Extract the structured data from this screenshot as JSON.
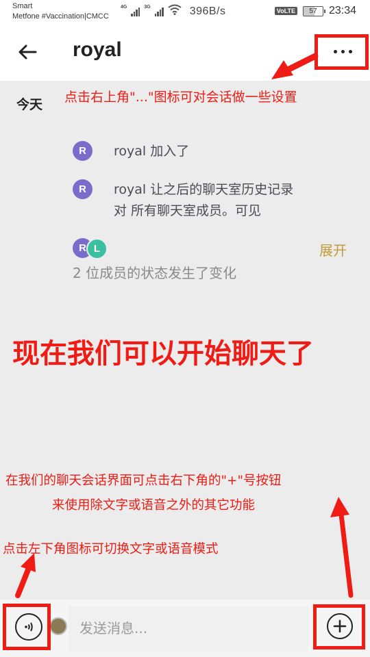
{
  "status_bar": {
    "carrier_line1": "Smart",
    "carrier_line2": "Metfone #Vaccination|CMCC",
    "net1": "4G",
    "net2": "3G",
    "net_rate": "396B/s",
    "volte": "VoLTE",
    "battery": "57",
    "battery_level": 0.57,
    "time": "23:34"
  },
  "header": {
    "title": "royal",
    "back_icon": "arrow-left-icon",
    "more_icon": "more-horizontal-icon"
  },
  "chat": {
    "day_label": "今天",
    "events": [
      {
        "avatar": "R",
        "text": "royal 加入了"
      },
      {
        "avatar": "R",
        "text_line1": "royal 让之后的聊天室历史记录",
        "text_line2": "对 所有聊天室成员。可见"
      }
    ],
    "member_change": {
      "avatars": [
        "R",
        "L"
      ],
      "expand_label": "展开",
      "text": "2 位成员的状态发生了变化"
    }
  },
  "annotations": {
    "settings_hint": "点击右上角\"...\"图标可对会话做一些设置",
    "start_chat": "现在我们可以开始聊天了",
    "plus_hint_line1": "在我们的聊天会话界面可点击右下角的\"+\"号按钮",
    "plus_hint_line2": "来使用除文字或语音之外的其它功能",
    "voice_hint": "点击左下角图标可切换文字或语音模式",
    "annotation_color": "#ee1c14"
  },
  "composer": {
    "placeholder": "发送消息...",
    "voice_icon": "voice-mode-icon",
    "plus_icon": "plus-circle-icon"
  },
  "colors": {
    "avatar_r": "#7a6ccb",
    "avatar_l": "#3cbfa0",
    "expand": "#c49b3a",
    "chat_bg": "#ececec"
  }
}
